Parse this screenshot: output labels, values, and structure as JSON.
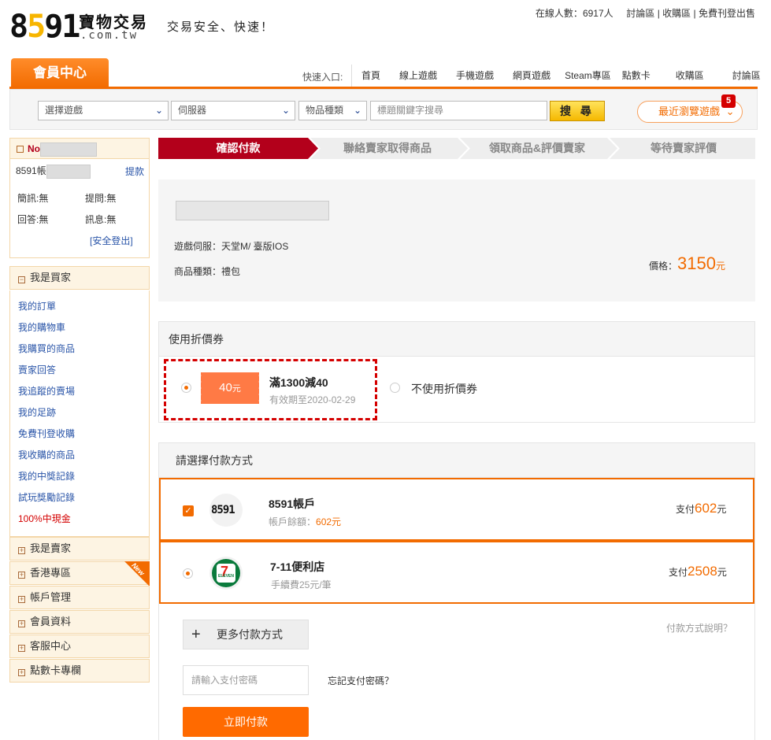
{
  "header": {
    "logo_num": "8591",
    "logo_cn": "寶物交易",
    "logo_domain": ".com.tw",
    "slogan": "交易安全、快速！",
    "online_label": "在線人數：",
    "online_count": "6917",
    "online_unit": "人",
    "links": [
      "討論區",
      "收購區",
      "免費刊登出售"
    ],
    "separator": "|"
  },
  "member_tab": "會員中心",
  "quick_nav": {
    "label": "快速入口:",
    "items": [
      "首頁",
      "線上遊戲",
      "手機遊戲",
      "網頁遊戲",
      "Steam專區",
      "點數卡",
      "收購區",
      "討論區"
    ]
  },
  "search": {
    "game_select": "選擇遊戲",
    "server_select": "伺服器",
    "type_select": "物品種類",
    "keyword_placeholder": "標題關鍵字搜尋",
    "button": "搜 尋",
    "recent_label": "最近瀏覽遊戲",
    "recent_badge": "5",
    "chevron": "⌄"
  },
  "sidebar": {
    "user_prefix": "No",
    "account_prefix": "8591帳",
    "withdraw": "提款",
    "stats": [
      {
        "label": "簡訊:",
        "value": "無"
      },
      {
        "label": "提問:",
        "value": "無"
      },
      {
        "label": "回答:",
        "value": "無"
      },
      {
        "label": "訊息:",
        "value": "無"
      }
    ],
    "logout": "[安全登出]",
    "buyer_title": "我是買家",
    "buyer_links": [
      "我的訂單",
      "我的購物車",
      "我購買的商品",
      "賣家回答",
      "我追蹤的賣場",
      "我的足跡",
      "免費刊登收購",
      "我收購的商品",
      "我的中獎記錄",
      "試玩獎勵記錄",
      "100%中現金"
    ],
    "sections": [
      "我是賣家",
      "香港專區",
      "帳戶管理",
      "會員資料",
      "客服中心",
      "點數卡專欄"
    ],
    "new_tag": "New",
    "minus": "−",
    "plus": "+"
  },
  "steps": [
    "確認付款",
    "聯絡賣家取得商品",
    "領取商品&評價賣家",
    "等待賣家評價"
  ],
  "product": {
    "server_label": "遊戲伺服：",
    "server_value": "天堂M/ 臺版IOS",
    "type_label": "商品種類：",
    "type_value": "禮包",
    "price_label": "價格：",
    "price_value": "3150",
    "price_unit": "元"
  },
  "coupon": {
    "title": "使用折價券",
    "amount": "40",
    "amount_unit": "元",
    "name": "滿1300減40",
    "expiry": "有效期至2020-02-29",
    "no_coupon": "不使用折價券"
  },
  "payment": {
    "title": "請選擇付款方式",
    "methods": [
      {
        "name": "8591帳戶",
        "sub_label": "帳戶餘額：",
        "sub_value": "602元",
        "pay_label": "支付",
        "pay_value": "602",
        "pay_unit": "元",
        "logo": "8591"
      },
      {
        "name": "7-11便利店",
        "sub_label": "手續費25元/筆",
        "sub_value": "",
        "pay_label": "支付",
        "pay_value": "2508",
        "pay_unit": "元",
        "logo": "ELEVEN"
      }
    ],
    "more_methods": "更多付款方式",
    "help": "付款方式說明？",
    "password_placeholder": "請輸入支付密碼",
    "forgot": "忘記支付密碼？",
    "submit": "立即付款",
    "check": "✓",
    "plus": "+"
  },
  "colors": {
    "accent": "#f26b00",
    "step_active": "#b3001b",
    "link": "#2a55a8"
  }
}
